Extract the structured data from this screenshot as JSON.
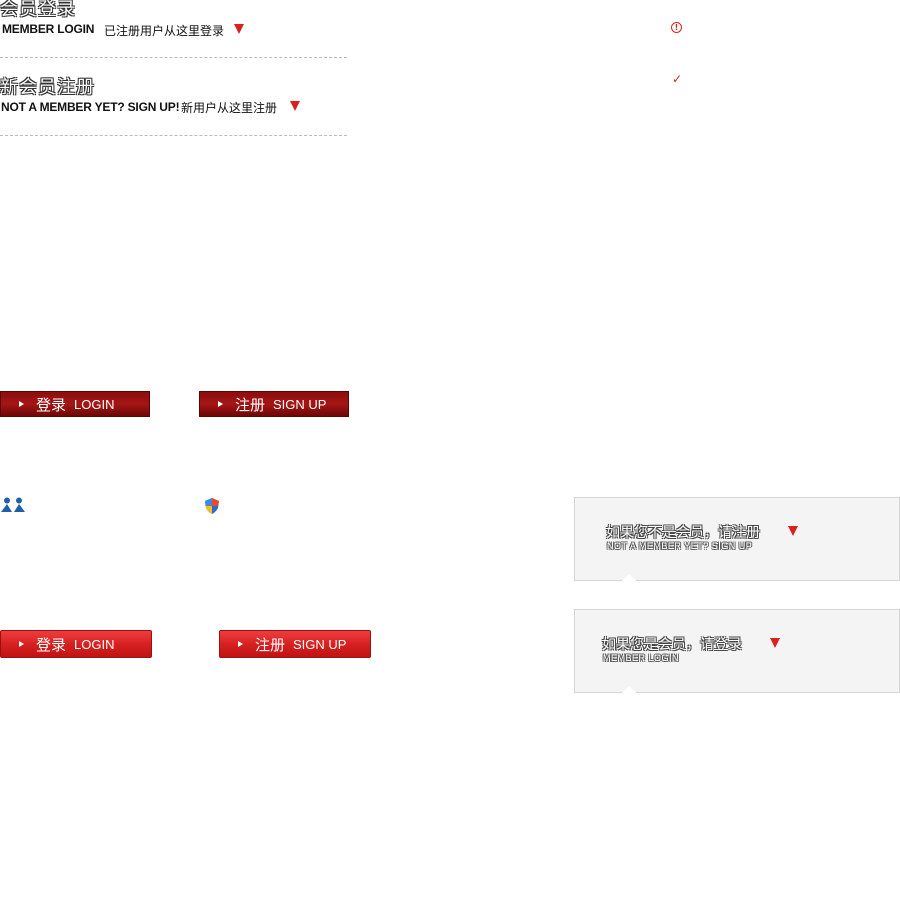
{
  "login_section": {
    "title": "会员登录",
    "subtitle": "MEMBER LOGIN",
    "hint": "已注册用户从这里登录"
  },
  "register_section": {
    "title": "新会员注册",
    "subtitle": "NOT A MEMBER YET? SIGN UP!",
    "hint": "新用户从这里注册"
  },
  "status_icons": {
    "warning": "!",
    "check": "✓"
  },
  "buttons_dark": {
    "login_cn": "登录",
    "login_en": "LOGIN",
    "signup_cn": "注册",
    "signup_en": "SIGN UP"
  },
  "buttons_bright": {
    "login_cn": "登录",
    "login_en": "LOGIN",
    "signup_cn": "注册",
    "signup_en": "SIGN UP"
  },
  "tooltip_register": {
    "cn": "如果您不是会员，请注册",
    "en": "NOT A MEMBER YET? SIGN UP"
  },
  "tooltip_login": {
    "cn": "如果您是会员，请登录",
    "en": "MEMBER LOGIN"
  },
  "colors": {
    "accent_red": "#d8221f",
    "dark_button": "#8c0d0d",
    "bright_button": "#d41f1f",
    "tooltip_bg": "#f4f4f4"
  }
}
